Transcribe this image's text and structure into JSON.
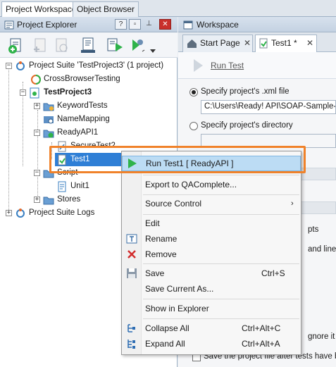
{
  "top_tabs": {
    "workspace": "Project Workspace",
    "object_browser": "Object Browser"
  },
  "left_panel": {
    "title": "Project Explorer",
    "title_buttons": {
      "help": "?",
      "dock": "▫",
      "pin": "⊥",
      "close": "✕"
    }
  },
  "tree": {
    "suite": "Project Suite 'TestProject3' (1 project)",
    "crossbrowser": "CrossBrowserTesting",
    "project": "TestProject3",
    "keyword_tests": "KeywordTests",
    "name_mapping": "NameMapping",
    "readyapi": "ReadyAPI1",
    "secure_test": "SecureTest2",
    "test1": "Test1",
    "script": "Script",
    "unit1": "Unit1",
    "stores": "Stores",
    "suite_logs": "Project Suite Logs"
  },
  "right_panel": {
    "title": "Workspace",
    "tabs": [
      {
        "label": "Start Page",
        "close": "✕"
      },
      {
        "label": "Test1 *",
        "close": "✕"
      }
    ],
    "run_test": "Run Test",
    "radio_xml": "Specify project's .xml file",
    "xml_path": "C:\\Users\\Ready! API\\SOAP-Sample-Pro",
    "radio_dir": "Specify project's directory",
    "frag_pts": "pts",
    "frag_and_line": "and line",
    "frag_ignore": "gnore it",
    "save_after": "Save the project file after tests have be"
  },
  "context_menu": {
    "items": [
      {
        "label": "Run Test1  [ ReadyAPI ]",
        "shortcut": ""
      },
      {
        "label": "Export to QAComplete...",
        "shortcut": ""
      },
      {
        "label": "Source Control",
        "shortcut": ""
      },
      {
        "label": "Edit",
        "shortcut": ""
      },
      {
        "label": "Rename",
        "shortcut": ""
      },
      {
        "label": "Remove",
        "shortcut": ""
      },
      {
        "label": "Save",
        "shortcut": "Ctrl+S"
      },
      {
        "label": "Save Current As...",
        "shortcut": ""
      },
      {
        "label": "Show in Explorer",
        "shortcut": ""
      },
      {
        "label": "Collapse All",
        "shortcut": "Ctrl+Alt+C"
      },
      {
        "label": "Expand All",
        "shortcut": "Ctrl+Alt+A"
      }
    ],
    "submenu_arrow": "›"
  },
  "colors": {
    "accent_orange": "#f0822a",
    "highlight": "#bcdcf4",
    "run_green": "#2fb34a"
  }
}
